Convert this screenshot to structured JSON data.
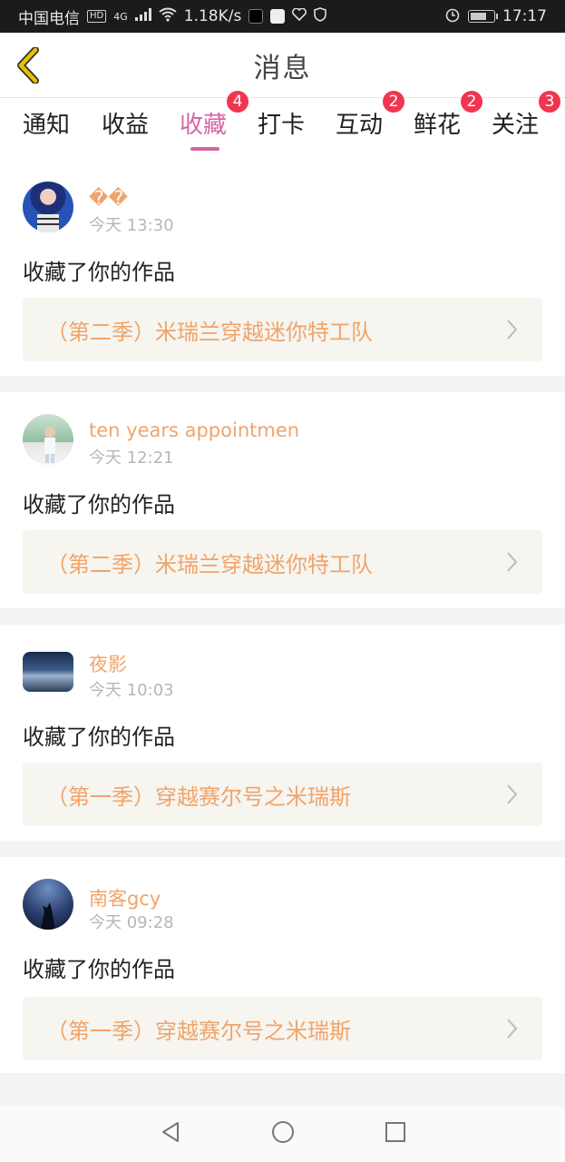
{
  "statusbar": {
    "carrier": "中国电信",
    "hd": "HD",
    "net": "4G",
    "speed": "1.18K/s",
    "time": "17:17"
  },
  "navbar": {
    "title": "消息",
    "back_icon": "chevron-left-icon"
  },
  "tabs": [
    {
      "label": "通知",
      "badge": ""
    },
    {
      "label": "收益",
      "badge": ""
    },
    {
      "label": "收藏",
      "badge": "4",
      "active": true
    },
    {
      "label": "打卡",
      "badge": ""
    },
    {
      "label": "互动",
      "badge": "2"
    },
    {
      "label": "鲜花",
      "badge": "2"
    },
    {
      "label": "关注",
      "badge": "3"
    }
  ],
  "items": [
    {
      "user": "��",
      "time": "今天 13:30",
      "action": "收藏了你的作品",
      "work": "（第二季）米瑞兰穿越迷你特工队"
    },
    {
      "user": "ten years appointmen",
      "time": "今天 12:21",
      "action": "收藏了你的作品",
      "work": "（第二季）米瑞兰穿越迷你特工队"
    },
    {
      "user": "夜影",
      "time": "今天 10:03",
      "action": "收藏了你的作品",
      "work": "（第一季）穿越赛尔号之米瑞斯"
    },
    {
      "user": "南客gcy",
      "time": "今天 09:28",
      "action": "收藏了你的作品",
      "work": "（第一季）穿越赛尔号之米瑞斯"
    }
  ],
  "colors": {
    "accent": "#d466a4",
    "badge": "#f2354e",
    "username": "#f0a46c",
    "work_bg": "#f6f5ef",
    "back_icon": "#e8c200"
  },
  "bottom_nav": [
    "back-triangle-icon",
    "home-circle-icon",
    "recents-square-icon"
  ]
}
